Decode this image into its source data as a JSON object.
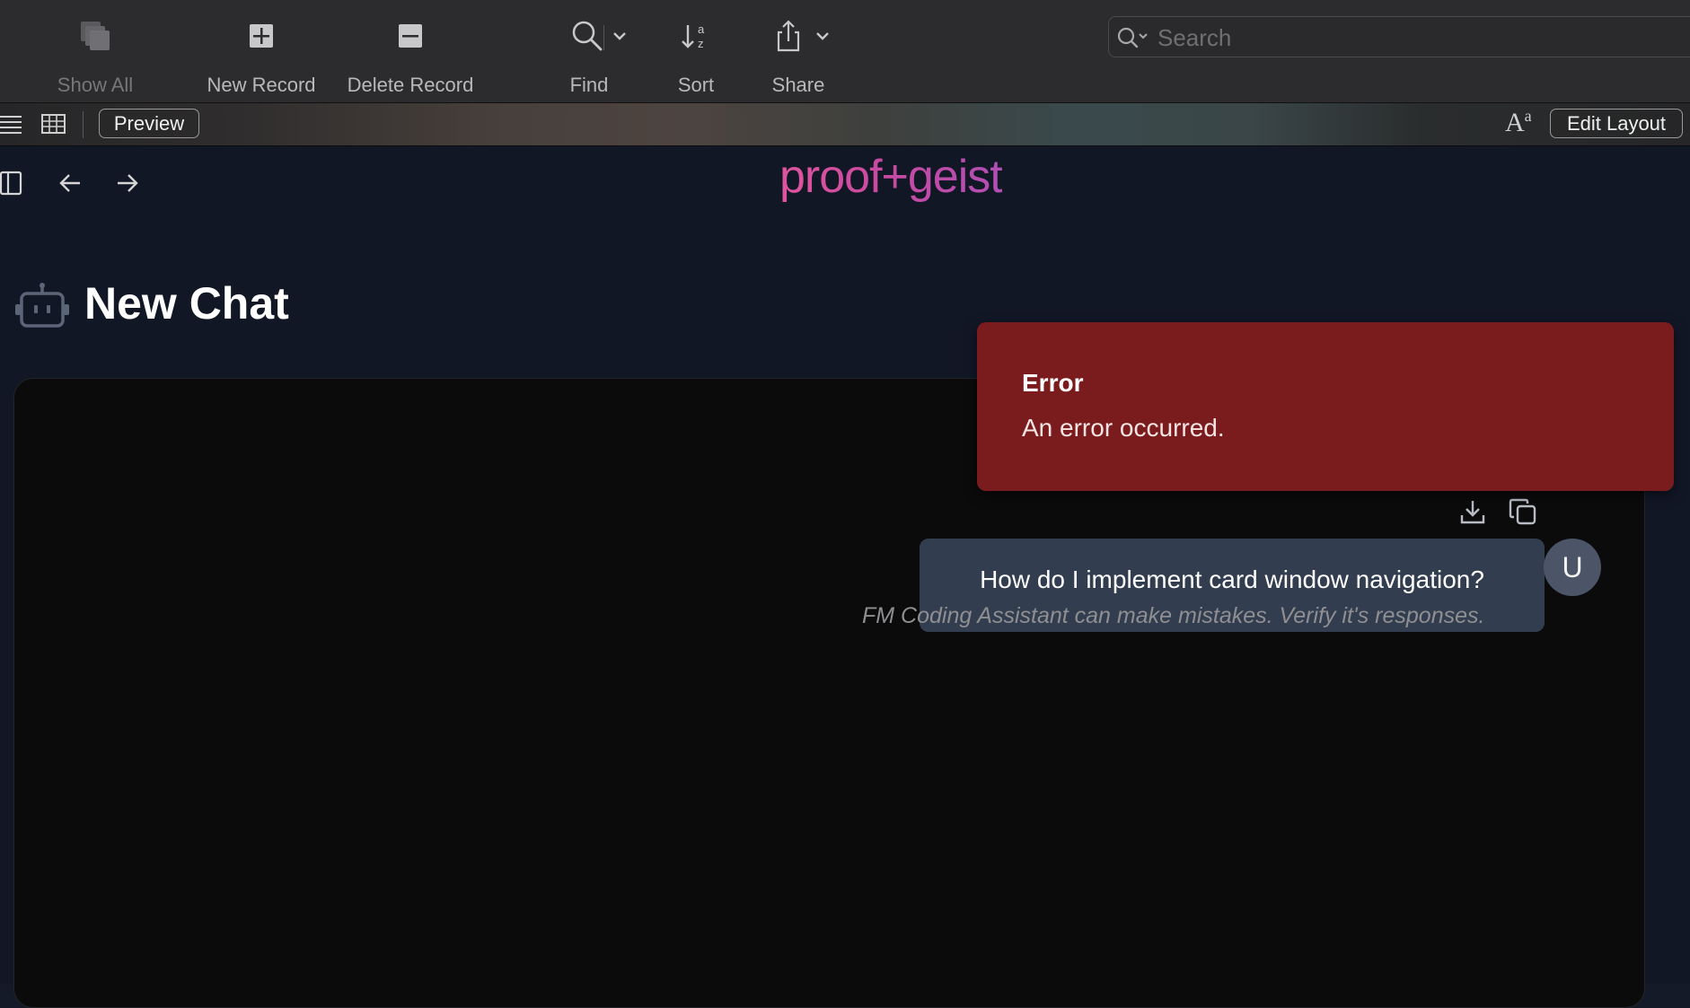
{
  "toolbar": {
    "show_all": "Show All",
    "new_record": "New Record",
    "delete_record": "Delete Record",
    "find": "Find",
    "sort": "Sort",
    "share": "Share",
    "search_placeholder": "Search"
  },
  "layout_bar": {
    "preview": "Preview",
    "edit_layout": "Edit Layout",
    "font_size_glyph": "A",
    "font_size_sup": "a"
  },
  "webview": {
    "brand": "proof+geist",
    "page_title": "New Chat",
    "message": "How do I implement card window navigation?",
    "avatar_initial": "U",
    "disclaimer": "FM Coding Assistant can make mistakes. Verify it's responses."
  },
  "toast": {
    "title": "Error",
    "message": "An error occurred."
  },
  "colors": {
    "toolbar_bg": "#2c2c2e",
    "page_bg": "#121726",
    "chat_bg": "#0b0b0c",
    "bubble_bg": "#323d4f",
    "error_bg": "#7a1c1e",
    "brand_pink": "#e0559e"
  },
  "icons": [
    "show-all-icon",
    "new-record-icon",
    "delete-record-icon",
    "find-icon",
    "sort-icon",
    "share-icon",
    "search-icon",
    "list-view-icon",
    "table-view-icon",
    "sidebar-toggle-icon",
    "back-arrow-icon",
    "forward-arrow-icon",
    "bot-icon",
    "download-icon",
    "copy-icon"
  ]
}
